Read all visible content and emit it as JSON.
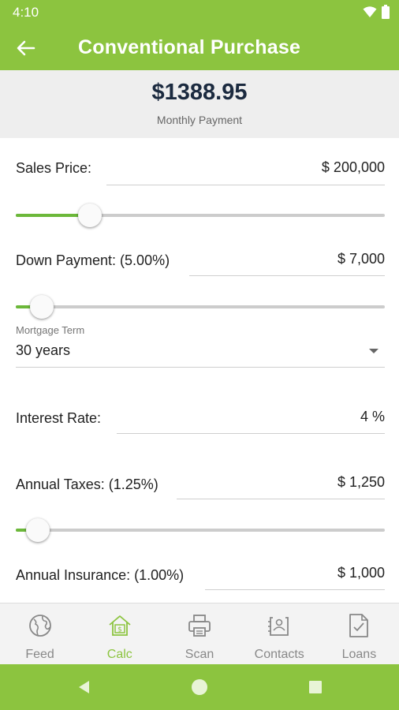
{
  "status_bar": {
    "time": "4:10"
  },
  "app_bar": {
    "title": "Conventional Purchase",
    "back_icon": "arrow-left-icon"
  },
  "summary": {
    "amount": "$1388.95",
    "label": "Monthly Payment"
  },
  "fields": {
    "sales_price": {
      "label": "Sales Price:",
      "value": "$ 200,000",
      "slider_percent": 20
    },
    "down_payment": {
      "label": "Down Payment: (5.00%)",
      "value": "$ 7,000",
      "slider_percent": 7
    },
    "mortgage_term": {
      "caption": "Mortgage Term",
      "value": "30 years"
    },
    "interest_rate": {
      "label": "Interest Rate:",
      "value": "4 %"
    },
    "annual_taxes": {
      "label": "Annual Taxes: (1.25%)",
      "value": "$ 1,250",
      "slider_percent": 6
    },
    "annual_insurance": {
      "label": "Annual Insurance: (1.00%)",
      "value": "$ 1,000"
    }
  },
  "bottom_nav": {
    "items": [
      {
        "label": "Feed",
        "icon": "globe-icon",
        "active": false
      },
      {
        "label": "Calc",
        "icon": "house-dollar-icon",
        "active": true
      },
      {
        "label": "Scan",
        "icon": "printer-icon",
        "active": false
      },
      {
        "label": "Contacts",
        "icon": "contacts-icon",
        "active": false
      },
      {
        "label": "Loans",
        "icon": "document-check-icon",
        "active": false
      }
    ]
  },
  "colors": {
    "brand": "#8cc43f",
    "slider_fill": "#6cb83a",
    "amount_text": "#1b2a3f"
  }
}
